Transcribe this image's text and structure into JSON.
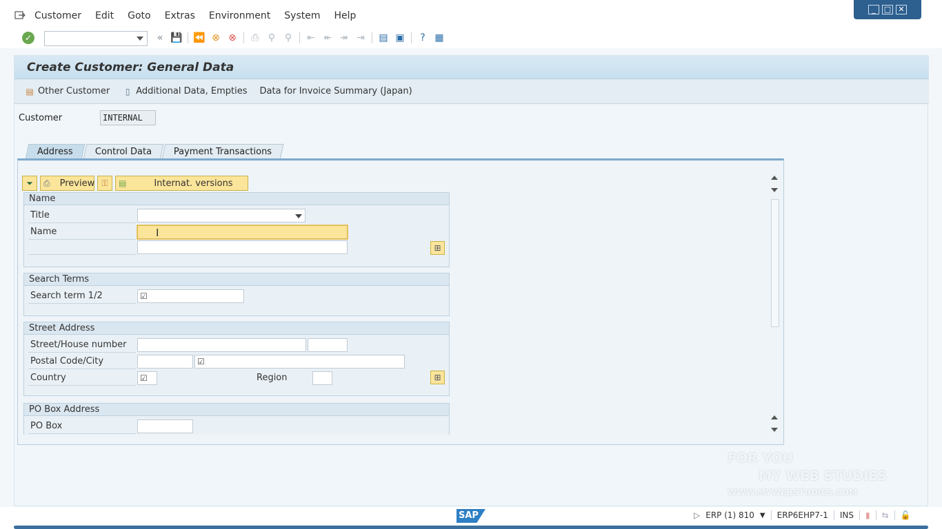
{
  "menu": {
    "items": [
      "Customer",
      "Edit",
      "Goto",
      "Extras",
      "Environment",
      "System",
      "Help"
    ]
  },
  "toolbar": {
    "command_field_value": ""
  },
  "page": {
    "title": "Create Customer: General Data",
    "app_toolbar": [
      "Other Customer",
      "Additional Data, Empties",
      "Data for Invoice Summary (Japan)"
    ],
    "customer_label": "Customer",
    "customer_value": "INTERNAL"
  },
  "tabs": [
    "Address",
    "Control Data",
    "Payment Transactions"
  ],
  "inner_toolbar": {
    "preview": "Preview",
    "internat_versions": "Internat. versions"
  },
  "groups": {
    "name": {
      "title": "Name",
      "title_label": "Title",
      "name_label": "Name"
    },
    "search_terms": {
      "title": "Search Terms",
      "search_label": "Search term 1/2"
    },
    "street_address": {
      "title": "Street Address",
      "street_label": "Street/House number",
      "postal_label": "Postal Code/City",
      "country_label": "Country",
      "region_label": "Region"
    },
    "po_box": {
      "title": "PO Box Address",
      "po_box_label": "PO Box"
    }
  },
  "status": {
    "system": "ERP (1) 810",
    "server": "ERP6EHP7-1",
    "mode": "INS"
  },
  "watermark": {
    "line1": "FOR YOU",
    "line2": "MY WEB STUDIES",
    "line3": "WWW.MYWEBSTUDIES.COM"
  },
  "colors": {
    "accent": "#2a6ca8",
    "highlight": "#fbe59a",
    "title_bar": "#c8dfee"
  }
}
